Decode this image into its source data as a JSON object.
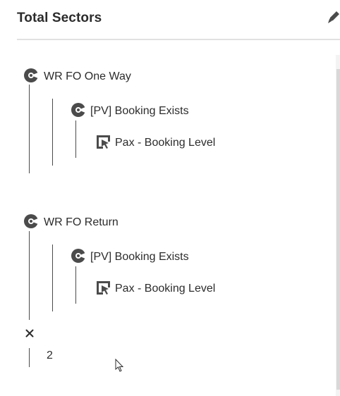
{
  "panel": {
    "title": "Total Sectors"
  },
  "containers": [
    {
      "label": "WR FO One Way",
      "child": {
        "label": "[PV] Booking Exists",
        "child": {
          "label": "Pax - Booking Level"
        }
      }
    },
    {
      "label": "WR FO Return",
      "child": {
        "label": "[PV] Booking Exists",
        "child": {
          "label": "Pax - Booking Level"
        }
      }
    }
  ],
  "operator": {
    "symbol": "×",
    "value": "2"
  },
  "icons": {
    "edit": "pencil-icon",
    "segment": "segment-icon",
    "dimension": "dimension-icon",
    "multiply": "multiply-icon"
  }
}
